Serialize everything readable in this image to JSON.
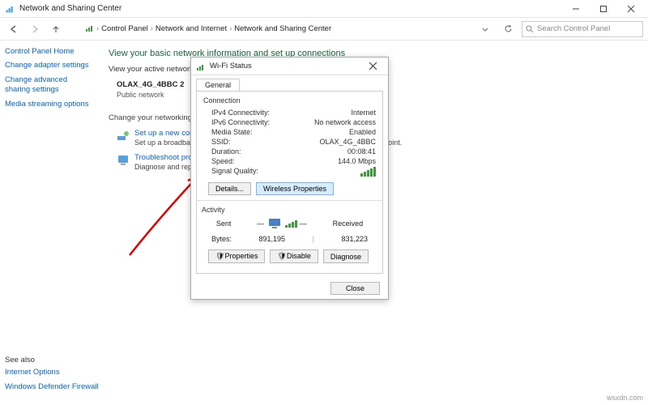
{
  "window": {
    "title": "Network and Sharing Center",
    "breadcrumb": [
      "Control Panel",
      "Network and Internet",
      "Network and Sharing Center"
    ],
    "search_placeholder": "Search Control Panel"
  },
  "sidebar": {
    "home": "Control Panel Home",
    "links": [
      "Change adapter settings",
      "Change advanced sharing settings",
      "Media streaming options"
    ],
    "seealso_hdr": "See also",
    "seealso": [
      "Internet Options",
      "Windows Defender Firewall"
    ]
  },
  "content": {
    "heading": "View your basic network information and set up connections",
    "subheading": "View your active networks",
    "network_name": "OLAX_4G_4BBC 2",
    "network_type": "Public network",
    "change_hdr": "Change your networking settings",
    "tasks": [
      {
        "title": "Set up a new connection or network",
        "desc": "Set up a broadband, dial-up, or VPN connection; or set up a router or access point."
      },
      {
        "title": "Troubleshoot problems",
        "desc": "Diagnose and repair network problems, or get troubleshooting information."
      }
    ]
  },
  "dialog": {
    "title": "Wi-Fi Status",
    "tab": "General",
    "connection_label": "Connection",
    "rows": {
      "ipv4": {
        "k": "IPv4 Connectivity:",
        "v": "Internet"
      },
      "ipv6": {
        "k": "IPv6 Connectivity:",
        "v": "No network access"
      },
      "media": {
        "k": "Media State:",
        "v": "Enabled"
      },
      "ssid": {
        "k": "SSID:",
        "v": "OLAX_4G_4BBC"
      },
      "duration": {
        "k": "Duration:",
        "v": "00:08:41"
      },
      "speed": {
        "k": "Speed:",
        "v": "144.0 Mbps"
      },
      "signal": {
        "k": "Signal Quality:"
      }
    },
    "btn_details": "Details...",
    "btn_wireless": "Wireless Properties",
    "activity_label": "Activity",
    "sent_label": "Sent",
    "received_label": "Received",
    "bytes_label": "Bytes:",
    "bytes_sent": "891,195",
    "bytes_received": "831,223",
    "btn_properties": "Properties",
    "btn_disable": "Disable",
    "btn_diagnose": "Diagnose",
    "btn_close": "Close"
  },
  "watermark": "wsxdn.com"
}
